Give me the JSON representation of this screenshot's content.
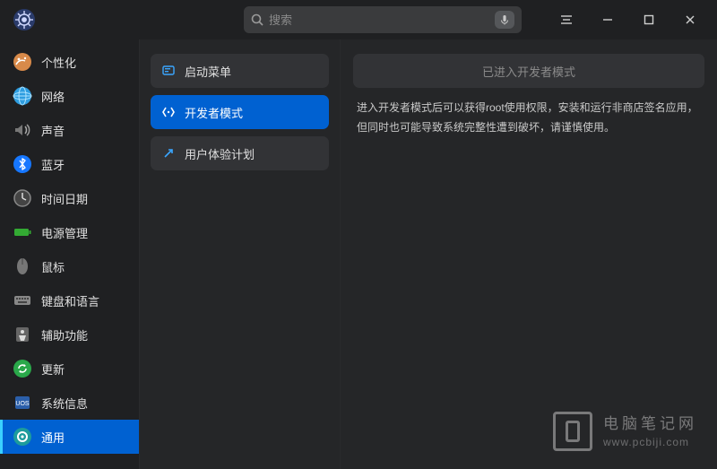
{
  "header": {
    "search_placeholder": "搜索"
  },
  "sidebar": {
    "items": [
      {
        "label": "个性化",
        "icon": "personalize"
      },
      {
        "label": "网络",
        "icon": "network"
      },
      {
        "label": "声音",
        "icon": "sound"
      },
      {
        "label": "蓝牙",
        "icon": "bluetooth"
      },
      {
        "label": "时间日期",
        "icon": "clock"
      },
      {
        "label": "电源管理",
        "icon": "battery"
      },
      {
        "label": "鼠标",
        "icon": "mouse"
      },
      {
        "label": "键盘和语言",
        "icon": "keyboard"
      },
      {
        "label": "辅助功能",
        "icon": "accessibility"
      },
      {
        "label": "更新",
        "icon": "update"
      },
      {
        "label": "系统信息",
        "icon": "sysinfo"
      },
      {
        "label": "通用",
        "icon": "general",
        "selected": true
      }
    ]
  },
  "subnav": {
    "items": [
      {
        "label": "启动菜单",
        "icon": "boot"
      },
      {
        "label": "开发者模式",
        "icon": "dev",
        "selected": true
      },
      {
        "label": "用户体验计划",
        "icon": "ux"
      }
    ]
  },
  "content": {
    "status": "已进入开发者模式",
    "description": "进入开发者模式后可以获得root使用权限，安装和运行非商店签名应用，但同时也可能导致系统完整性遭到破坏，请谨慎使用。"
  },
  "watermark": {
    "line1": "电脑笔记网",
    "line2": "www.pcbiji.com"
  }
}
